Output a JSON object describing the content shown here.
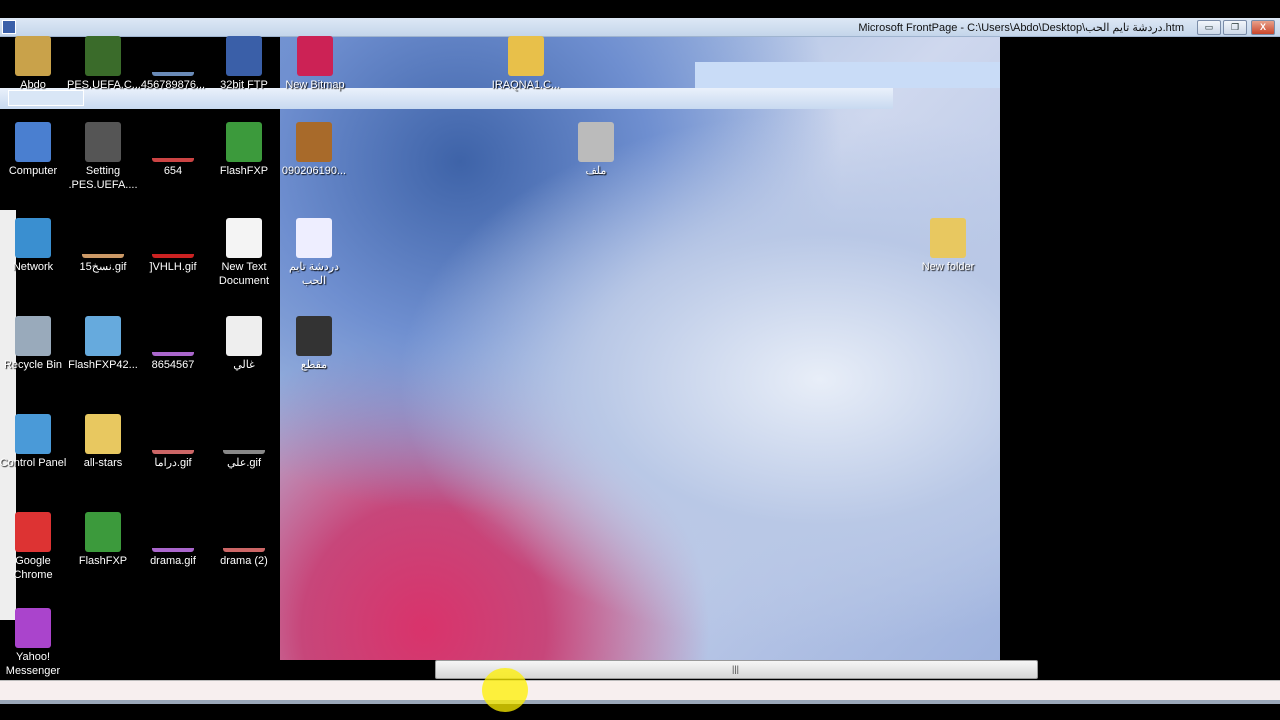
{
  "window": {
    "title": "Microsoft FrontPage - C:\\Users\\Abdo\\Desktop\\دردشة تايم الحب.htm",
    "minimize": "▭",
    "restore": "❐",
    "close": "X"
  },
  "desktop_icons": [
    {
      "label": "Abdo",
      "icon": "user-folder-icon",
      "color": "#c9a24a"
    },
    {
      "label": "PES.UEFA.C...",
      "icon": "game-shortcut-icon",
      "color": "#3a6b2a"
    },
    {
      "label": "456789876...",
      "icon": "gif-file-icon",
      "color": "#6a8bb8"
    },
    {
      "label": "32bit FTP",
      "icon": "ftp-icon",
      "color": "#3a5fa8"
    },
    {
      "label": "New Bitmap",
      "icon": "bitmap-icon",
      "color": "#c25"
    },
    {
      "label": "IRAQNA1.C...",
      "icon": "media-icon",
      "color": "#e8c04a"
    },
    {
      "label": "Computer",
      "icon": "computer-icon",
      "color": "#4a7fd0"
    },
    {
      "label": "Setting .PES.UEFA....",
      "icon": "game-shortcut-icon",
      "color": "#555"
    },
    {
      "label": "654",
      "icon": "gif-file-icon",
      "color": "#c44"
    },
    {
      "label": "FlashFXP",
      "icon": "flashfxp-icon",
      "color": "#3c9a3c"
    },
    {
      "label": "090206190...",
      "icon": "image-file-icon",
      "color": "#a86a2a"
    },
    {
      "label": "ملف",
      "icon": "file-icon",
      "color": "#bbb"
    },
    {
      "label": "Network",
      "icon": "network-icon",
      "color": "#3a8fd0"
    },
    {
      "label": "نسخ15.gif",
      "icon": "gif-file-icon",
      "color": "#c96"
    },
    {
      "label": "]VHLH.gif",
      "icon": "gif-file-icon",
      "color": "#c22"
    },
    {
      "label": "New Text Document",
      "icon": "text-file-icon",
      "color": "#f4f4f4"
    },
    {
      "label": "دردشة تايم الحب",
      "icon": "html-file-icon",
      "color": "#eef"
    },
    {
      "label": "New folder",
      "icon": "folder-icon",
      "color": "#e8c860"
    },
    {
      "label": "Recycle Bin",
      "icon": "recycle-bin-icon",
      "color": "#9ab"
    },
    {
      "label": "FlashFXP42...",
      "icon": "installer-icon",
      "color": "#6ad"
    },
    {
      "label": "8654567",
      "icon": "gif-file-icon",
      "color": "#a6c"
    },
    {
      "label": "غالي",
      "icon": "mp3-file-icon",
      "color": "#eee"
    },
    {
      "label": "مقطع",
      "icon": "video-file-icon",
      "color": "#333"
    },
    {
      "label": "Control Panel",
      "icon": "control-panel-icon",
      "color": "#4a9ad8"
    },
    {
      "label": "all-stars",
      "icon": "folder-icon",
      "color": "#e8c860"
    },
    {
      "label": "دراما.gif",
      "icon": "gif-file-icon",
      "color": "#c66"
    },
    {
      "label": "علي.gif",
      "icon": "gif-file-icon",
      "color": "#888"
    },
    {
      "label": "Google Chrome",
      "icon": "chrome-icon",
      "color": "#d33"
    },
    {
      "label": "FlashFXP",
      "icon": "flashfxp-icon",
      "color": "#3c9a3c"
    },
    {
      "label": "drama.gif",
      "icon": "gif-file-icon",
      "color": "#a6c"
    },
    {
      "label": "drama (2)",
      "icon": "gif-file-icon",
      "color": "#c66"
    },
    {
      "label": "Yahoo! Messenger",
      "icon": "yahoo-messenger-icon",
      "color": "#a4c"
    }
  ]
}
